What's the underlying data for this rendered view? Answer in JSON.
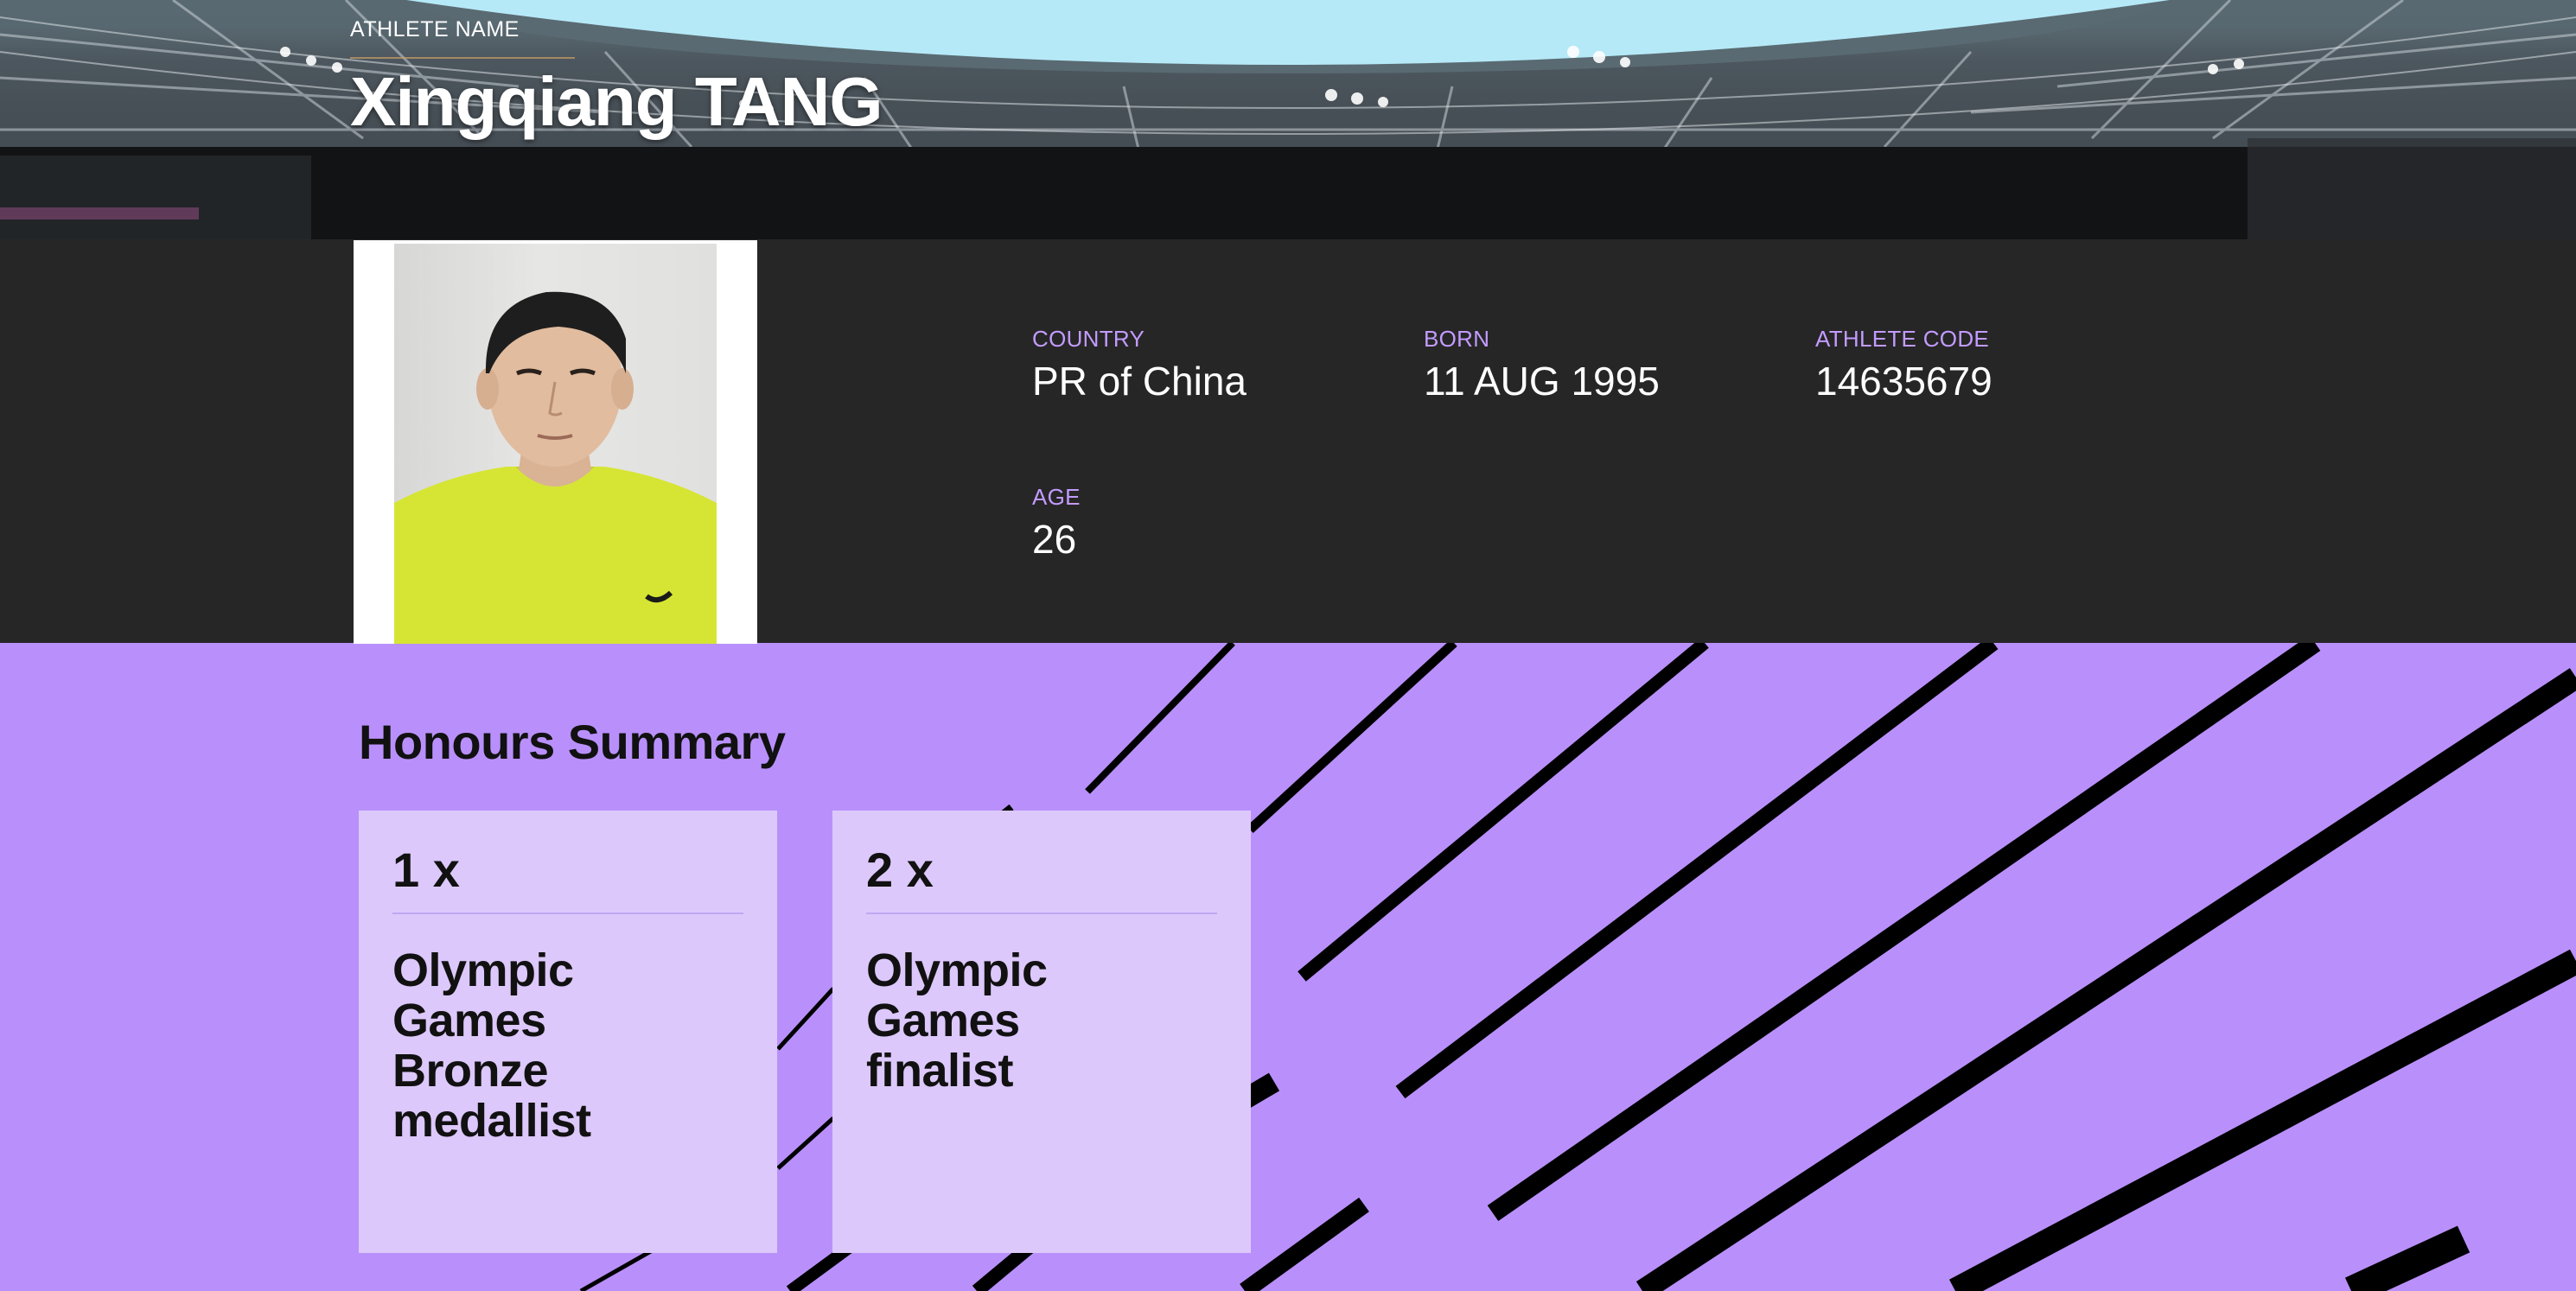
{
  "hero": {
    "label": "ATHLETE NAME",
    "name": "Xingqiang TANG"
  },
  "profile": {
    "photo_alt": "Athlete portrait",
    "fields": [
      {
        "label": "COUNTRY",
        "value": "PR of China"
      },
      {
        "label": "BORN",
        "value": "11 AUG 1995"
      },
      {
        "label": "ATHLETE CODE",
        "value": "14635679"
      },
      {
        "label": "AGE",
        "value": "26"
      }
    ]
  },
  "honours": {
    "title": "Honours Summary",
    "cards": [
      {
        "count": "1 x",
        "text": "Olympic Games Bronze medallist"
      },
      {
        "count": "2 x",
        "text": "Olympic Games finalist"
      }
    ]
  },
  "colors": {
    "accent_purple": "#b990fb",
    "card_bg": "#dcc8fb",
    "label_purple": "#c39bff",
    "info_band": "#262626"
  }
}
